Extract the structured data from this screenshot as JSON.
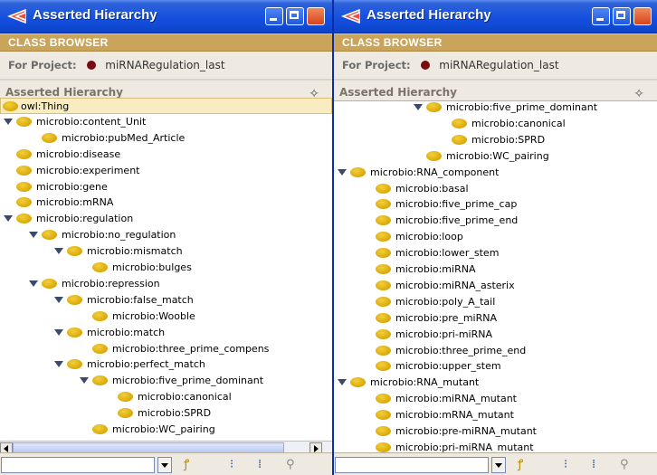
{
  "window_title": "Asserted Hierarchy",
  "panel_title": "CLASS BROWSER",
  "for_project_label": "For Project:",
  "project_name": "miRNARegulation_last",
  "hierarchy_label": "Asserted Hierarchy",
  "left_tree": [
    {
      "label": "owl:Thing",
      "depth": 0,
      "toggle": false,
      "selected": true,
      "icon": false
    },
    {
      "label": "microbio:content_Unit",
      "depth": 0,
      "toggle": true
    },
    {
      "label": "microbio:pubMed_Article",
      "depth": 1,
      "toggle": false
    },
    {
      "label": "microbio:disease",
      "depth": 0,
      "toggle": false
    },
    {
      "label": "microbio:experiment",
      "depth": 0,
      "toggle": false
    },
    {
      "label": "microbio:gene",
      "depth": 0,
      "toggle": false
    },
    {
      "label": "microbio:mRNA",
      "depth": 0,
      "toggle": false
    },
    {
      "label": "microbio:regulation",
      "depth": 0,
      "toggle": true
    },
    {
      "label": "microbio:no_regulation",
      "depth": 1,
      "toggle": true
    },
    {
      "label": "microbio:mismatch",
      "depth": 2,
      "toggle": true
    },
    {
      "label": "microbio:bulges",
      "depth": 3,
      "toggle": false
    },
    {
      "label": "microbio:repression",
      "depth": 1,
      "toggle": true
    },
    {
      "label": "microbio:false_match",
      "depth": 2,
      "toggle": true
    },
    {
      "label": "microbio:Wooble",
      "depth": 3,
      "toggle": false
    },
    {
      "label": "microbio:match",
      "depth": 2,
      "toggle": true
    },
    {
      "label": "microbio:three_prime_compens",
      "depth": 3,
      "toggle": false
    },
    {
      "label": "microbio:perfect_match",
      "depth": 2,
      "toggle": true
    },
    {
      "label": "microbio:five_prime_dominant",
      "depth": 3,
      "toggle": true
    },
    {
      "label": "microbio:canonical",
      "depth": 4,
      "toggle": false
    },
    {
      "label": "microbio:SPRD",
      "depth": 4,
      "toggle": false
    },
    {
      "label": "microbio:WC_pairing",
      "depth": 3,
      "toggle": false
    },
    {
      "label": "microbio:RNA_component",
      "depth": 0,
      "toggle": true,
      "partial": true
    }
  ],
  "right_tree": [
    {
      "label": "microbio:five_prime_dominant",
      "depth": 3,
      "toggle": true
    },
    {
      "label": "microbio:canonical",
      "depth": 4,
      "toggle": false
    },
    {
      "label": "microbio:SPRD",
      "depth": 4,
      "toggle": false
    },
    {
      "label": "microbio:WC_pairing",
      "depth": 3,
      "toggle": false
    },
    {
      "label": "microbio:RNA_component",
      "depth": 0,
      "toggle": true
    },
    {
      "label": "microbio:basal",
      "depth": 1,
      "toggle": false
    },
    {
      "label": "microbio:five_prime_cap",
      "depth": 1,
      "toggle": false
    },
    {
      "label": "microbio:five_prime_end",
      "depth": 1,
      "toggle": false
    },
    {
      "label": "microbio:loop",
      "depth": 1,
      "toggle": false
    },
    {
      "label": "microbio:lower_stem",
      "depth": 1,
      "toggle": false
    },
    {
      "label": "microbio:miRNA",
      "depth": 1,
      "toggle": false
    },
    {
      "label": "microbio:miRNA_asterix",
      "depth": 1,
      "toggle": false
    },
    {
      "label": "microbio:poly_A_tail",
      "depth": 1,
      "toggle": false
    },
    {
      "label": "microbio:pre_miRNA",
      "depth": 1,
      "toggle": false
    },
    {
      "label": "microbio:pri-miRNA",
      "depth": 1,
      "toggle": false
    },
    {
      "label": "microbio:three_prime_end",
      "depth": 1,
      "toggle": false
    },
    {
      "label": "microbio:upper_stem",
      "depth": 1,
      "toggle": false
    },
    {
      "label": "microbio:RNA_mutant",
      "depth": 0,
      "toggle": true
    },
    {
      "label": "microbio:miRNA_mutant",
      "depth": 1,
      "toggle": false
    },
    {
      "label": "microbio:mRNA_mutant",
      "depth": 1,
      "toggle": false
    },
    {
      "label": "microbio:pre-miRNA_mutant",
      "depth": 1,
      "toggle": false
    },
    {
      "label": "microbio:pri-miRNA_mutant",
      "depth": 1,
      "toggle": false
    }
  ],
  "find_input": {
    "value": "",
    "placeholder": ""
  },
  "colors": {
    "titlebar": "#1550e0",
    "class_browser": "#c9a45a",
    "class_icon": "#e0b000",
    "selection": "#f8ecc0"
  },
  "icons": [
    "app-icon",
    "minimize-icon",
    "maximize-icon",
    "close-icon",
    "add-subclass-icon",
    "find-icon",
    "expand-icon",
    "collapse-icon",
    "search-icon"
  ]
}
